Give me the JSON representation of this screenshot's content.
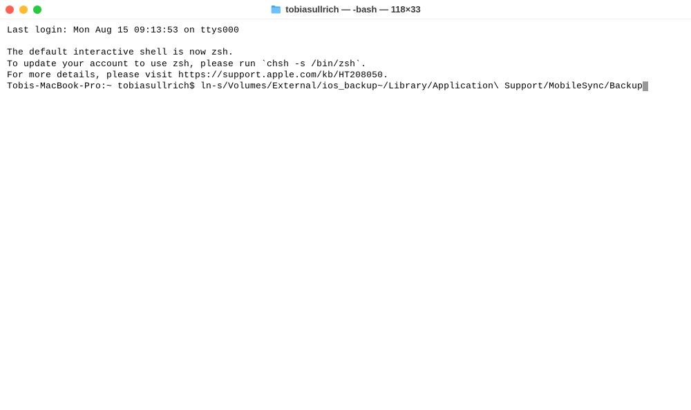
{
  "titlebar": {
    "title": "tobiasullrich — -bash — 118×33"
  },
  "terminal": {
    "lines": {
      "last_login": "Last login: Mon Aug 15 09:13:53 on ttys000",
      "zsh_notice_1": "The default interactive shell is now zsh.",
      "zsh_notice_2": "To update your account to use zsh, please run `chsh -s /bin/zsh`.",
      "zsh_notice_3": "For more details, please visit https://support.apple.com/kb/HT208050.",
      "prompt": "Tobis-MacBook-Pro:~ tobiasullrich$ ",
      "command": "ln-s/Volumes/External/ios_backup~/Library/Application\\ Support/MobileSync/Backup"
    }
  }
}
